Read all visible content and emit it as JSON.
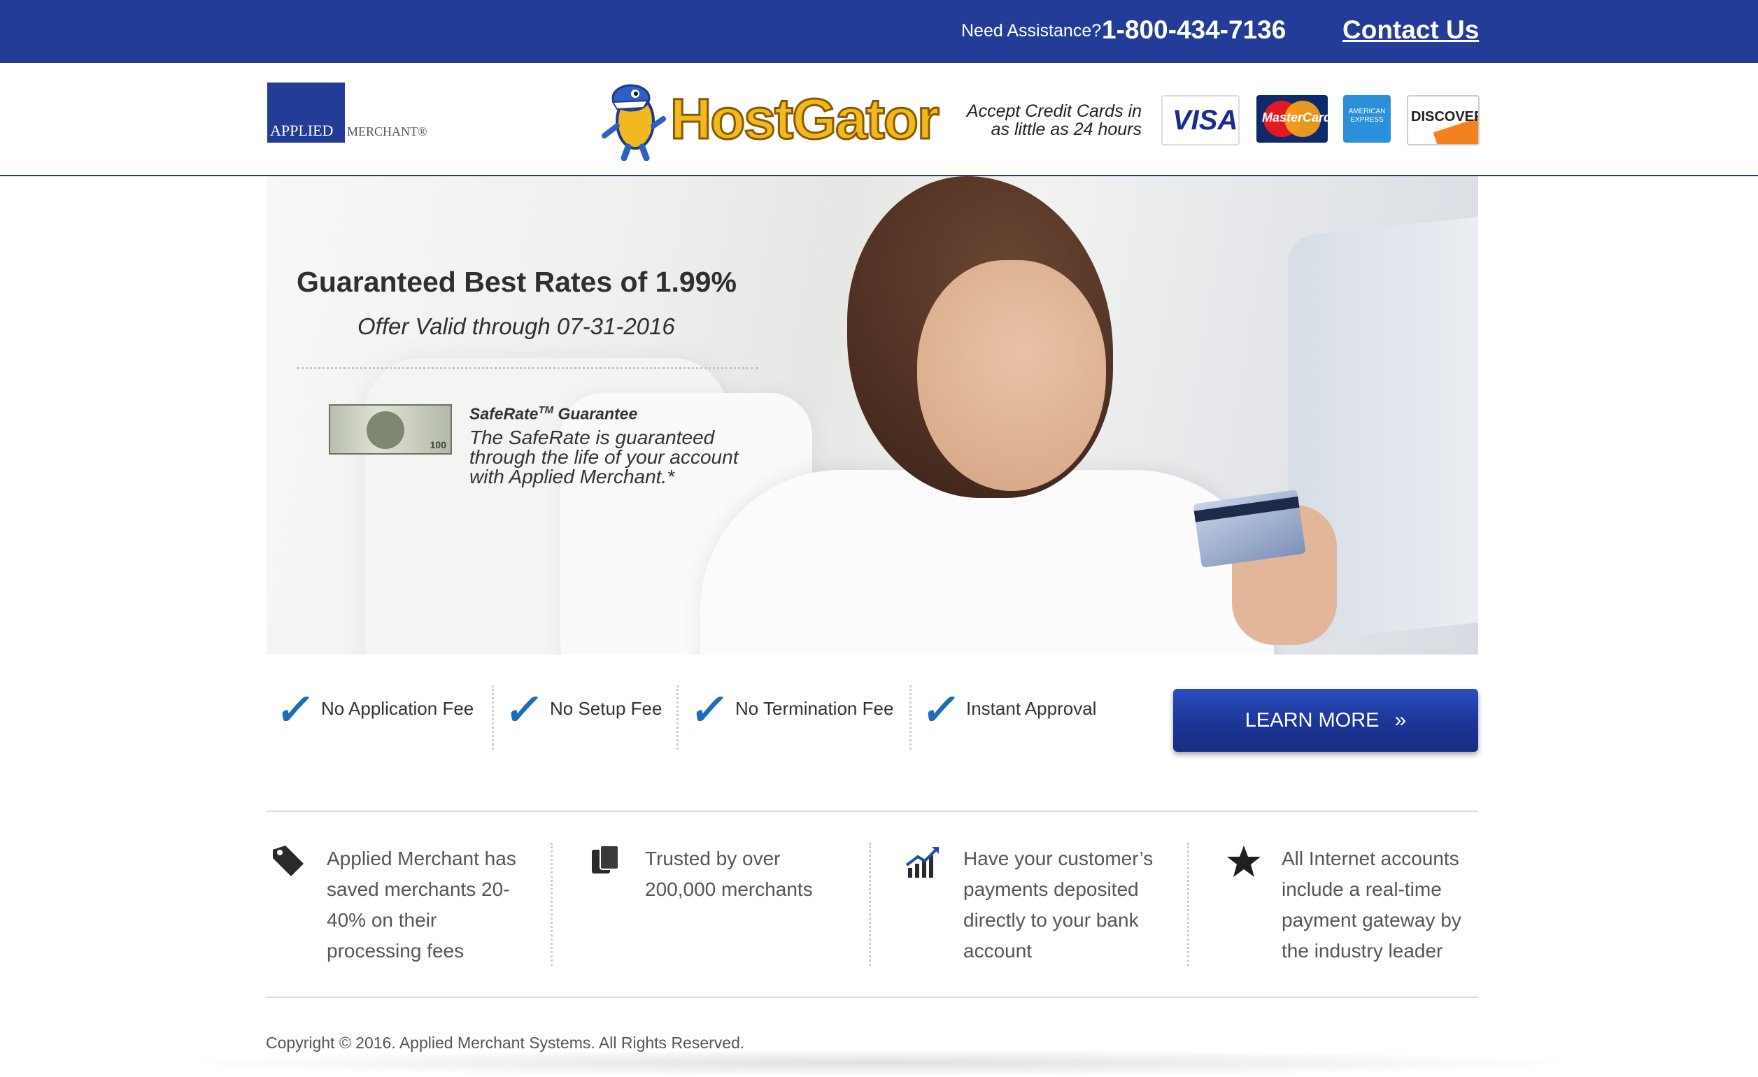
{
  "topbar": {
    "assist_label": "Need Assistance?",
    "phone": "1-800-434-7136",
    "contact_label": "Contact Us"
  },
  "header": {
    "logo": {
      "applied": "APPLIED",
      "merchant": "MERCHANT®"
    },
    "partner_name": "HostGator",
    "accept_line1": "Accept Credit Cards in",
    "accept_line2": "as little as 24 hours",
    "cards": [
      {
        "name": "visa",
        "text": "VISA"
      },
      {
        "name": "mastercard",
        "text": "MasterCard"
      },
      {
        "name": "american-express",
        "text": "AMERICAN EXPRESS"
      },
      {
        "name": "discover",
        "text": "DISCOVER"
      }
    ]
  },
  "hero": {
    "title": "Guaranteed Best Rates of 1.99%",
    "offer": "Offer Valid through 07-31-2016",
    "safe_head": "SafeRate",
    "safe_sup": "TM",
    "safe_head_rest": " Guarantee",
    "safe_body": "The SafeRate is guaranteed through the life of your account with Applied Merchant.*",
    "bill_number": "100"
  },
  "features": {
    "items": [
      "No Application Fee",
      "No Setup Fee",
      "No Termination Fee",
      "Instant Approval"
    ],
    "cta_label": "LEARN MORE",
    "cta_arrow": "»"
  },
  "info": [
    {
      "icon": "tag-icon",
      "text": "Applied Merchant has saved merchants 20-40% on their processing fees"
    },
    {
      "icon": "documents-icon",
      "text": "Trusted by over 200,000 merchants"
    },
    {
      "icon": "growth-chart-icon",
      "text": "Have your customer’s payments deposited directly to your bank account"
    },
    {
      "icon": "star-icon",
      "text": "All Internet accounts include a real-time payment gateway by the industry leader"
    }
  ],
  "footer": {
    "copyright": "Copyright © 2016. Applied Merchant Systems. All Rights Reserved."
  },
  "colors": {
    "brand_blue": "#233c97",
    "check_blue": "#1c6db8",
    "hostgator_yellow": "#f2b81f"
  }
}
